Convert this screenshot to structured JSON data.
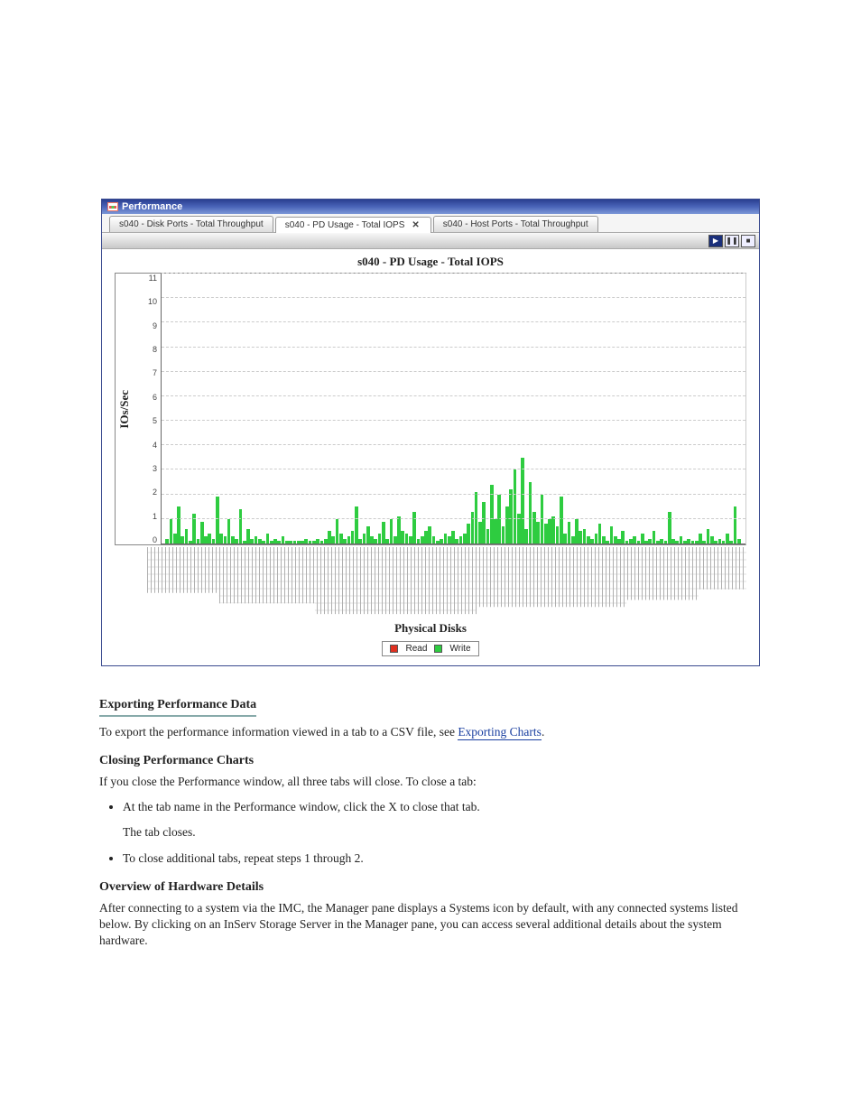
{
  "window": {
    "title": "Performance"
  },
  "tabs": {
    "0": {
      "label": "s040 - Disk Ports - Total Throughput"
    },
    "1": {
      "label": "s040 - PD Usage - Total IOPS"
    },
    "2": {
      "label": "s040 - Host Ports - Total Throughput"
    }
  },
  "toolbar": {
    "play": "▶",
    "pause": "❚❚",
    "stop": "■"
  },
  "chart_data": {
    "type": "bar",
    "title": "s040 - PD Usage - Total IOPS",
    "xlabel": "Physical Disks",
    "ylabel": "IOs/Sec",
    "ylim": [
      0,
      11
    ],
    "yticks": [
      "11",
      "10",
      "9",
      "8",
      "7",
      "6",
      "5",
      "4",
      "3",
      "2",
      "1",
      "0"
    ],
    "series": [
      {
        "name": "Read",
        "color": "#e03020",
        "values": []
      },
      {
        "name": "Write",
        "color": "#2ecc40",
        "values": [
          0.2,
          1.0,
          0.4,
          1.5,
          0.3,
          0.6,
          0.1,
          1.2,
          0.2,
          0.9,
          0.3,
          0.4,
          0.2,
          1.9,
          0.4,
          0.3,
          1.0,
          0.3,
          0.2,
          1.4,
          0.1,
          0.6,
          0.2,
          0.3,
          0.2,
          0.1,
          0.4,
          0.1,
          0.2,
          0.1,
          0.3,
          0.1,
          0.1,
          0.1,
          0.1,
          0.1,
          0.2,
          0.1,
          0.1,
          0.2,
          0.1,
          0.2,
          0.5,
          0.3,
          1.0,
          0.4,
          0.2,
          0.3,
          0.5,
          1.5,
          0.2,
          0.4,
          0.7,
          0.3,
          0.2,
          0.4,
          0.9,
          0.2,
          1.0,
          0.3,
          1.1,
          0.5,
          0.4,
          0.3,
          1.3,
          0.2,
          0.3,
          0.5,
          0.7,
          0.3,
          0.1,
          0.2,
          0.4,
          0.3,
          0.5,
          0.2,
          0.3,
          0.4,
          0.8,
          1.3,
          2.1,
          0.9,
          1.7,
          0.6,
          2.4,
          1.0,
          2.0,
          0.7,
          1.5,
          2.2,
          3.0,
          1.2,
          3.5,
          0.6,
          2.5,
          1.3,
          0.9,
          2.0,
          0.8,
          1.0,
          1.1,
          0.7,
          1.9,
          0.4,
          0.9,
          0.3,
          1.0,
          0.5,
          0.6,
          0.3,
          0.2,
          0.4,
          0.8,
          0.3,
          0.1,
          0.7,
          0.3,
          0.2,
          0.5,
          0.1,
          0.2,
          0.3,
          0.1,
          0.4,
          0.1,
          0.2,
          0.5,
          0.1,
          0.2,
          0.1,
          1.3,
          0.2,
          0.1,
          0.3,
          0.1,
          0.2,
          0.1,
          0.1,
          0.4,
          0.1,
          0.6,
          0.3,
          0.1,
          0.2,
          0.1,
          0.4,
          0.1,
          1.5,
          0.2
        ]
      }
    ]
  },
  "legend": {
    "0": {
      "label": "Read",
      "color": "#e03020"
    },
    "1": {
      "label": "Write",
      "color": "#2ecc40"
    }
  },
  "text": {
    "h_export": "Exporting Performance Data",
    "p_export": "To export the performance information viewed in a tab to a CSV file, see ",
    "link_export": "Exporting Charts",
    "period": ".",
    "h_close": "Closing Performance Charts",
    "p_close_1": "If you close the Performance window, all three tabs will close. To close a tab:",
    "li1": "At the tab name in the Performance window, click the X to close that tab.",
    "p_close_2": "The tab closes.",
    "li2": "To close additional tabs, repeat steps 1 through 2.",
    "h_hw": "Overview of Hardware Details",
    "p_hw": "After connecting to a system via the IMC, the Manager pane displays a Systems icon by default, with any connected systems listed below. By clicking on an InServ Storage Server in the Manager pane, you can access several additional details about the system hardware."
  }
}
